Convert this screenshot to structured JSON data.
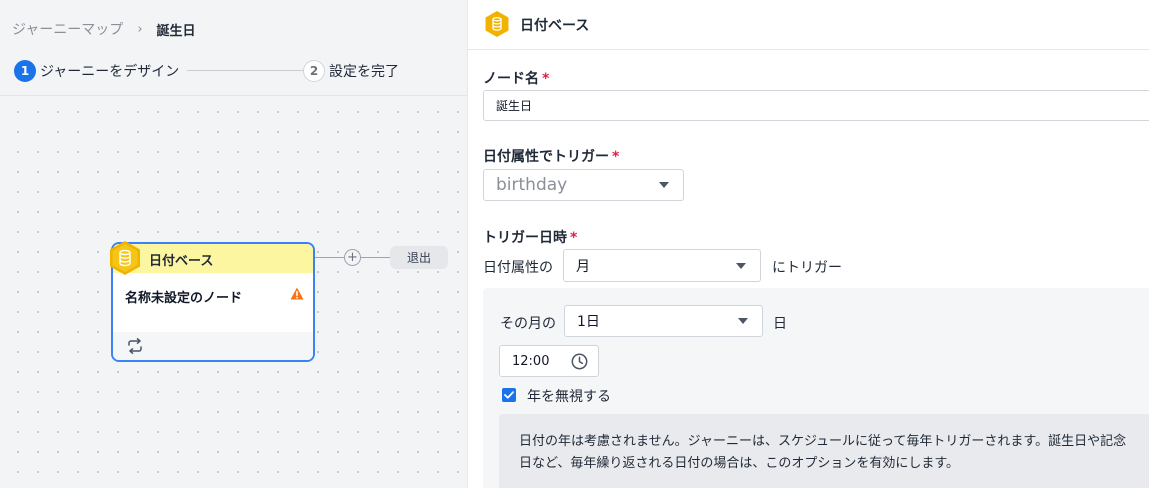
{
  "breadcrumb": {
    "parent": "ジャーニーマップ",
    "separator": "›",
    "current": "誕生日"
  },
  "steps": [
    {
      "number": "1",
      "label": "ジャーニーをデザイン",
      "active": true
    },
    {
      "number": "2",
      "label": "設定を完了",
      "active": false
    }
  ],
  "canvas": {
    "node": {
      "type_label": "日付ベース",
      "name": "名称未設定のノード",
      "icon": "database-icon",
      "header_color": "#fdf6a0",
      "border_color": "#3b82f6"
    },
    "add_symbol": "+",
    "exit_label": "退出"
  },
  "panel": {
    "title": "日付ベース",
    "node_name": {
      "label": "ノード名",
      "required": "*",
      "value": "誕生日"
    },
    "trigger_attribute": {
      "label": "日付属性でトリガー",
      "required": "*",
      "value": "birthday"
    },
    "trigger_datetime": {
      "label": "トリガー日時",
      "required": "*",
      "prefix": "日付属性の",
      "unit_value": "月",
      "suffix": "にトリガー",
      "day_prefix": "その月の",
      "day_value": "1日",
      "day_suffix": "日",
      "time_value": "12:00",
      "ignore_year_label": "年を無視する",
      "ignore_year_checked": true,
      "info_text": "日付の年は考慮されません。ジャーニーは、スケジュールに従って毎年トリガーされます。誕生日や記念日など、毎年繰り返される日付の場合は、このオプションを有効にします。"
    }
  },
  "colors": {
    "accent": "#1a73e8",
    "required": "#e11d48",
    "warning": "#f97316",
    "hexagon": "#f0b400"
  }
}
